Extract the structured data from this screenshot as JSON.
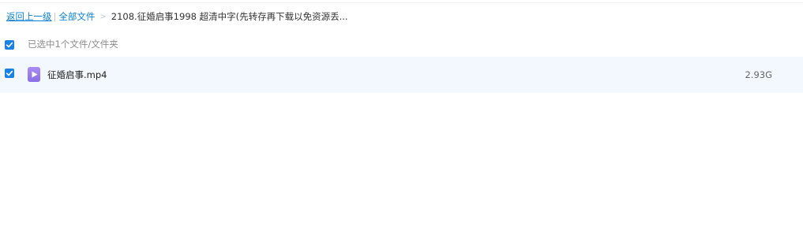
{
  "breadcrumb": {
    "back_label": "返回上一级",
    "all_files_label": "全部文件",
    "separator": ">",
    "current_folder": "2108.征婚启事1998 超清中字(先转存再下载以免资源丢..."
  },
  "selection": {
    "checked": true,
    "summary_text": "已选中1个文件/文件夹"
  },
  "files": [
    {
      "name": "征婚启事.mp4",
      "size": "2.93G",
      "type_icon": "video-file-icon",
      "checked": true
    }
  ],
  "colors": {
    "accent": "#1a82e3",
    "link": "#0a7fd8",
    "row_highlight": "#f3f8fe",
    "video_icon": "#8a6ee8"
  }
}
